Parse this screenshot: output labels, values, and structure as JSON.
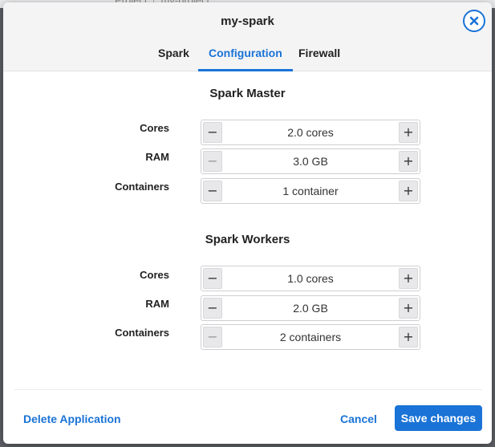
{
  "background": {
    "breadcrumb": [
      "Project",
      "my-project"
    ]
  },
  "modal": {
    "title": "my-spark",
    "close_icon": "close-circle-icon",
    "tabs": [
      {
        "label": "Spark",
        "active": false
      },
      {
        "label": "Configuration",
        "active": true
      },
      {
        "label": "Firewall",
        "active": false
      }
    ],
    "sections": [
      {
        "title": "Spark Master",
        "rows": [
          {
            "label": "Cores",
            "value": "2.0 cores",
            "minus_enabled": true
          },
          {
            "label": "RAM",
            "value": "3.0 GB",
            "minus_enabled": false
          },
          {
            "label": "Containers",
            "value": "1 container",
            "minus_enabled": true
          }
        ]
      },
      {
        "title": "Spark Workers",
        "rows": [
          {
            "label": "Cores",
            "value": "1.0 cores",
            "minus_enabled": true
          },
          {
            "label": "RAM",
            "value": "2.0 GB",
            "minus_enabled": true
          },
          {
            "label": "Containers",
            "value": "2 containers",
            "minus_enabled": false
          }
        ]
      }
    ],
    "stepper": {
      "minus_glyph": "−",
      "plus_glyph": "+"
    },
    "footer": {
      "delete_label": "Delete Application",
      "cancel_label": "Cancel",
      "save_label": "Save changes"
    }
  },
  "colors": {
    "accent": "#1a73d6",
    "header_bg": "#f4f4f5",
    "overlay": "#5b5f64"
  }
}
